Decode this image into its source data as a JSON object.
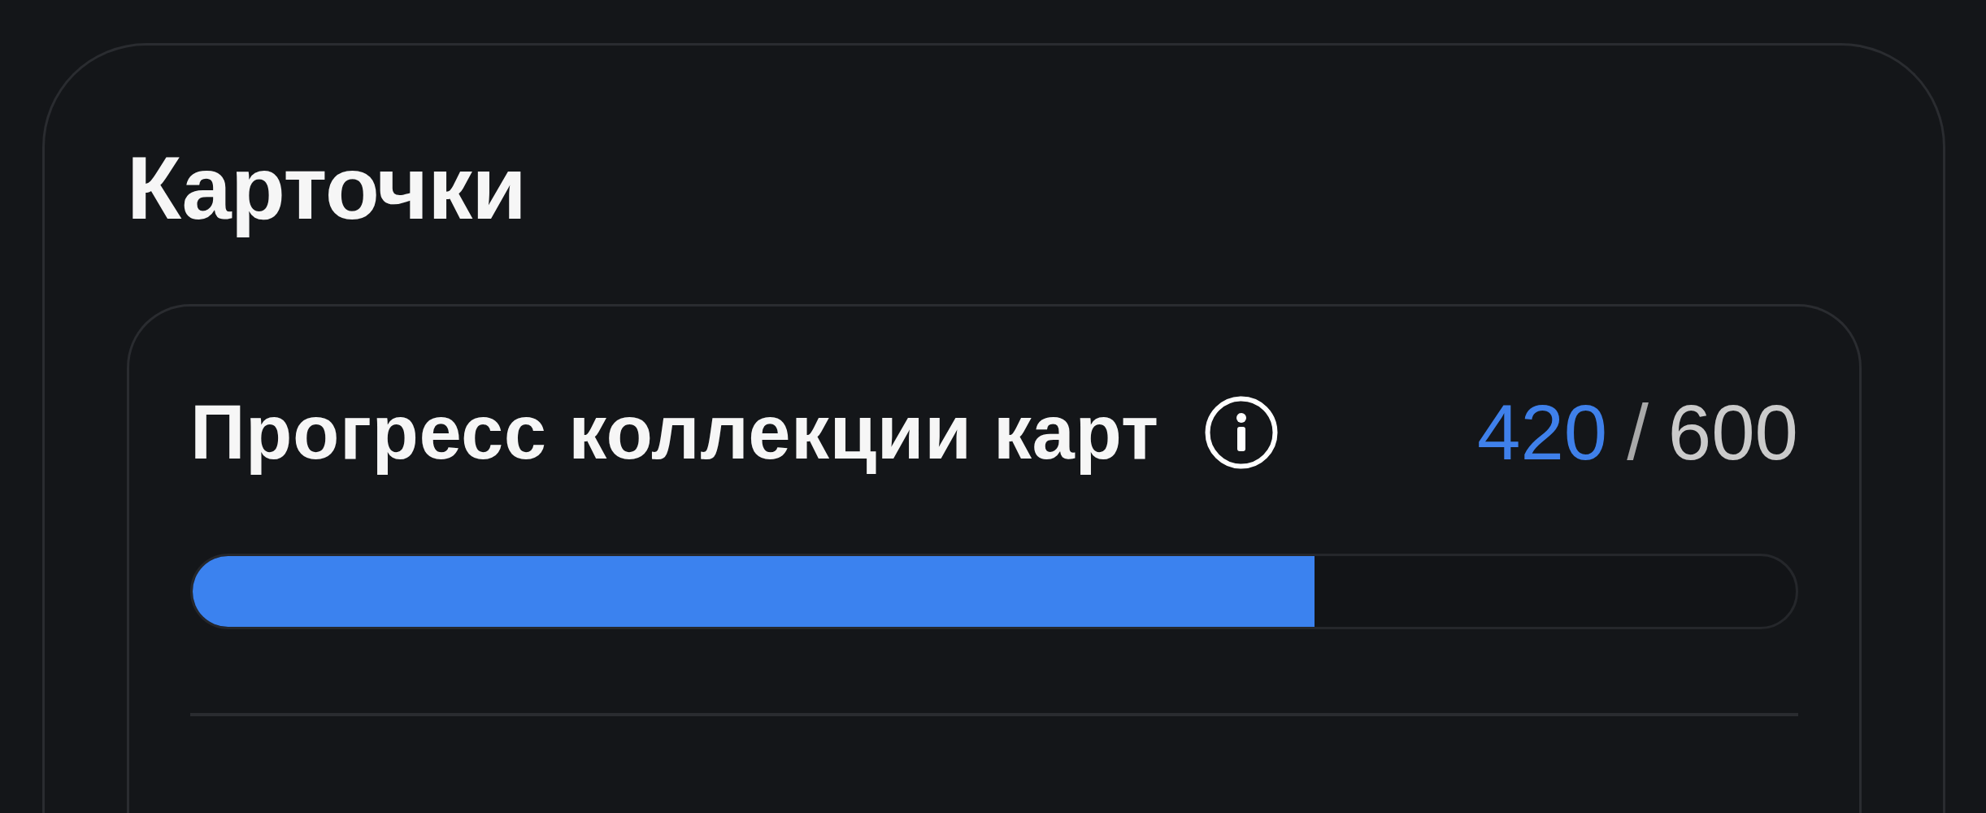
{
  "section": {
    "title": "Карточки"
  },
  "progress_card": {
    "label": "Прогресс коллекции карт",
    "current": "420",
    "separator": "/",
    "total": "600",
    "level": 0.7
  }
}
